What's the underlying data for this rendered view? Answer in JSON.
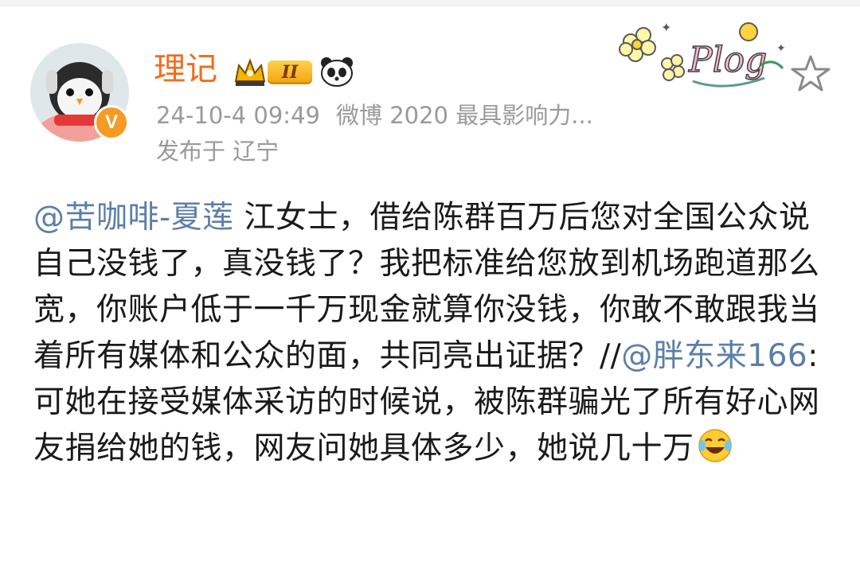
{
  "user": {
    "name": "理记",
    "verified_mark": "V",
    "level_badge": "II",
    "timestamp": "24-10-4 09:49",
    "source": "微博 2020 最具影响力...",
    "location": "发布于 辽宁"
  },
  "post": {
    "mention_1": "@苦咖啡-夏莲",
    "text_1": " 江女士，借给陈群百万后您对全国公众说自己没钱了，真没钱了？我把标准给您放到机场跑道那么宽，你账户低于一千万现金就算你没钱，你敢不敢跟我当着所有媒体和公众的面，共同亮出证据？//",
    "mention_2": "@胖东来166",
    "text_2": ":可她在接受媒体采访的时候说，被陈群骗光了所有好心网友捐给她的钱，网友问她具体多少，她说几十万",
    "emoji": "laughing-crying-emoji"
  },
  "decor": {
    "sticker_text": "Plog"
  },
  "colors": {
    "username": "#f26b1d",
    "mention": "#5b7fa8",
    "meta": "#9a9a9a",
    "body": "#1a1a1a"
  },
  "icons": [
    "avatar",
    "verified-badge-icon",
    "crown-badge-icon",
    "level-badge",
    "panda-icon",
    "plog-sticker",
    "star-icon",
    "laugh-cry-emoji-icon"
  ]
}
